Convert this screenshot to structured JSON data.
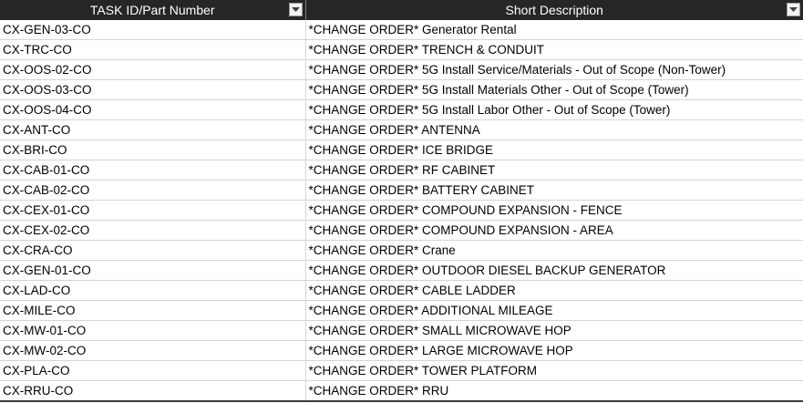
{
  "table": {
    "columns": [
      {
        "label": "TASK ID/Part Number",
        "filter_icon": "dropdown-arrow-icon"
      },
      {
        "label": "Short Description",
        "filter_icon": "dropdown-arrow-icon"
      }
    ],
    "rows": [
      [
        "CX-GEN-03-CO",
        "*CHANGE ORDER* Generator Rental"
      ],
      [
        "CX-TRC-CO",
        "*CHANGE ORDER* TRENCH & CONDUIT"
      ],
      [
        "CX-OOS-02-CO",
        "*CHANGE ORDER* 5G Install Service/Materials - Out of Scope (Non-Tower)"
      ],
      [
        "CX-OOS-03-CO",
        "*CHANGE ORDER* 5G Install Materials Other - Out of Scope (Tower)"
      ],
      [
        "CX-OOS-04-CO",
        "*CHANGE ORDER* 5G Install Labor Other - Out of Scope (Tower)"
      ],
      [
        "CX-ANT-CO",
        "*CHANGE ORDER* ANTENNA"
      ],
      [
        "CX-BRI-CO",
        "*CHANGE ORDER* ICE BRIDGE"
      ],
      [
        "CX-CAB-01-CO",
        "*CHANGE ORDER* RF CABINET"
      ],
      [
        "CX-CAB-02-CO",
        "*CHANGE ORDER* BATTERY CABINET"
      ],
      [
        "CX-CEX-01-CO",
        "*CHANGE ORDER* COMPOUND EXPANSION - FENCE"
      ],
      [
        "CX-CEX-02-CO",
        "*CHANGE ORDER* COMPOUND EXPANSION - AREA"
      ],
      [
        "CX-CRA-CO",
        "*CHANGE ORDER* Crane"
      ],
      [
        "CX-GEN-01-CO",
        "*CHANGE ORDER* OUTDOOR DIESEL BACKUP GENERATOR"
      ],
      [
        "CX-LAD-CO",
        "*CHANGE ORDER* CABLE LADDER"
      ],
      [
        "CX-MILE-CO",
        "*CHANGE ORDER* ADDITIONAL MILEAGE"
      ],
      [
        "CX-MW-01-CO",
        "*CHANGE ORDER* SMALL MICROWAVE HOP"
      ],
      [
        "CX-MW-02-CO",
        "*CHANGE ORDER* LARGE MICROWAVE HOP"
      ],
      [
        "CX-PLA-CO",
        "*CHANGE ORDER* TOWER PLATFORM"
      ],
      [
        "CX-RRU-CO",
        "*CHANGE ORDER* RRU"
      ]
    ]
  },
  "colors": {
    "header_bg": "#262626",
    "header_text": "#ffffff",
    "grid_line": "#d4d4d4"
  }
}
